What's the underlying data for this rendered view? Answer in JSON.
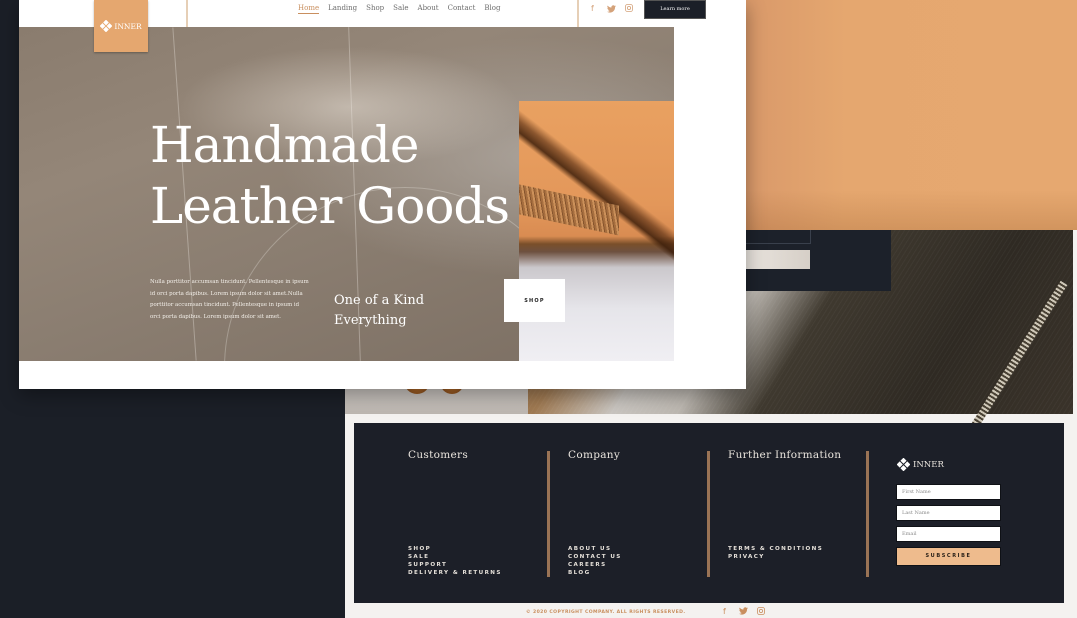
{
  "brand": {
    "name": "INNER",
    "accent": "#E5A76F",
    "dark": "#1C1F28"
  },
  "nav": {
    "links": [
      {
        "label": "Home",
        "active": true
      },
      {
        "label": "Landing"
      },
      {
        "label": "Shop"
      },
      {
        "label": "Sale"
      },
      {
        "label": "About"
      },
      {
        "label": "Contact"
      },
      {
        "label": "Blog"
      }
    ],
    "social": [
      "facebook-icon",
      "twitter-icon",
      "instagram-icon"
    ],
    "cta_label": "Learn more"
  },
  "hero": {
    "title_line1": "Handmade",
    "title_line2": "Leather Goods",
    "paragraph": "Nulla porttitor accumsan tincidunt. Pellentesque in ipsum id orci porta dapibus. Lorem ipsum dolor sit amet.Nulla porttitor accumsan tincidunt. Pellentesque in ipsum id orci porta dapibus. Lorem ipsum dolor sit amet.",
    "tagline_line1": "One of a Kind",
    "tagline_line2": "Everything",
    "shop_label": "SHOP"
  },
  "footer": {
    "columns": [
      {
        "title": "Customers",
        "links": [
          "SHOP",
          "SALE",
          "SUPPORT",
          "DELIVERY & RETURNS"
        ]
      },
      {
        "title": "Company",
        "links": [
          "ABOUT US",
          "CONTACT US",
          "CAREERS",
          "BLOG"
        ]
      },
      {
        "title": "Further Information",
        "links": [
          "TERMS & CONDITIONS",
          "PRIVACY"
        ]
      }
    ],
    "newsletter": {
      "first_name_placeholder": "First Name",
      "last_name_placeholder": "Last Name",
      "email_placeholder": "Email",
      "subscribe_label": "SUBSCRIBE"
    },
    "copyright": "© 2020 COPYRIGHT COMPANY. ALL RIGHTS RESERVED.",
    "social": [
      "facebook-icon",
      "twitter-icon",
      "instagram-icon"
    ]
  }
}
